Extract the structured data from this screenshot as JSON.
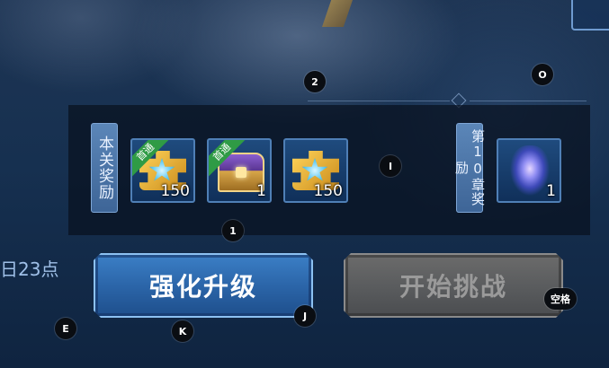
{
  "panel": {
    "stage_reward_label": "本关奖励",
    "chapter_reward_label": "第10章奖励"
  },
  "rewards": [
    {
      "icon": "puzzle-piece-icon",
      "badge": "首通",
      "quantity": "150"
    },
    {
      "icon": "treasure-chest-icon",
      "badge": "首通",
      "quantity": "1"
    },
    {
      "icon": "puzzle-piece-icon",
      "badge": "",
      "quantity": "150"
    }
  ],
  "chapter_reward": {
    "icon": "spirit-icon",
    "quantity": "1"
  },
  "deadline_text": "日23点",
  "buttons": {
    "upgrade": "强化升级",
    "start_challenge": "开始挑战"
  },
  "hotkeys": {
    "hint_2": "2",
    "hint_o": "O",
    "hint_i": "I",
    "hint_1": "1",
    "hint_e": "E",
    "hint_k": "K",
    "hint_j": "J",
    "hint_space": "空格"
  },
  "colors": {
    "upgrade_button": "#2a63a6",
    "challenge_button_disabled": "#595b5d",
    "first_clear_badge": "#2f9b45",
    "label_tab": "#4a74a8"
  }
}
